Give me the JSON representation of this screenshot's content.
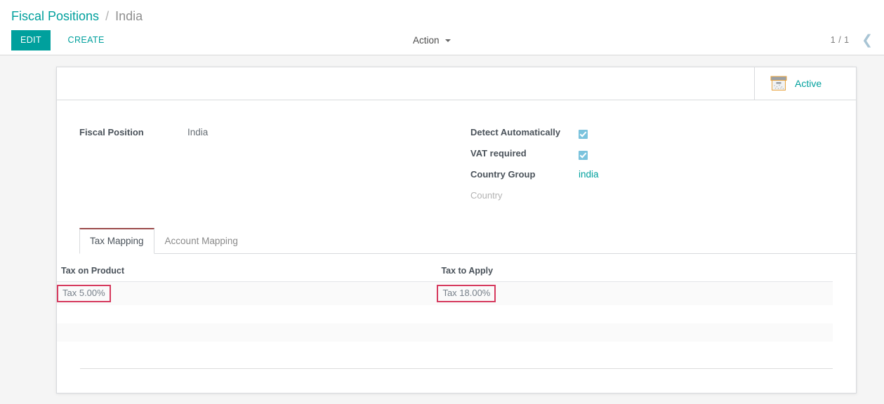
{
  "breadcrumb": {
    "root": "Fiscal Positions",
    "separator": "/",
    "current": "India"
  },
  "control_panel": {
    "edit_label": "EDIT",
    "create_label": "CREATE",
    "action_label": "Action",
    "pager_value": "1 / 1",
    "prev_icon": "chevron-left-icon",
    "caret_icon": "caret-down-icon"
  },
  "stat_button": {
    "label": "Active",
    "icon": "archive-box-icon"
  },
  "form": {
    "left": [
      {
        "label": "Fiscal Position",
        "value": "India",
        "type": "text"
      }
    ],
    "right": [
      {
        "label": "Detect Automatically",
        "value": "",
        "type": "checkbox",
        "checked": true
      },
      {
        "label": "VAT required",
        "value": "",
        "type": "checkbox",
        "checked": true
      },
      {
        "label": "Country Group",
        "value": "india",
        "type": "link"
      },
      {
        "label": "Country",
        "value": "",
        "type": "empty"
      }
    ]
  },
  "notebook": {
    "tabs": [
      {
        "label": "Tax Mapping",
        "active": true
      },
      {
        "label": "Account Mapping",
        "active": false
      }
    ]
  },
  "list": {
    "columns": [
      "Tax on Product",
      "Tax to Apply"
    ],
    "rows": [
      {
        "tax_on_product": "Tax 5.00%",
        "tax_to_apply": "Tax 18.00%",
        "highlighted": true
      }
    ]
  },
  "colors": {
    "accent_teal": "#00a09d",
    "checkbox_blue": "#7bc3dd",
    "highlight_red": "#d63a5e",
    "tab_active_border": "#9b4a4a",
    "page_background": "#f5f5f5",
    "label_text": "#4a525a"
  }
}
